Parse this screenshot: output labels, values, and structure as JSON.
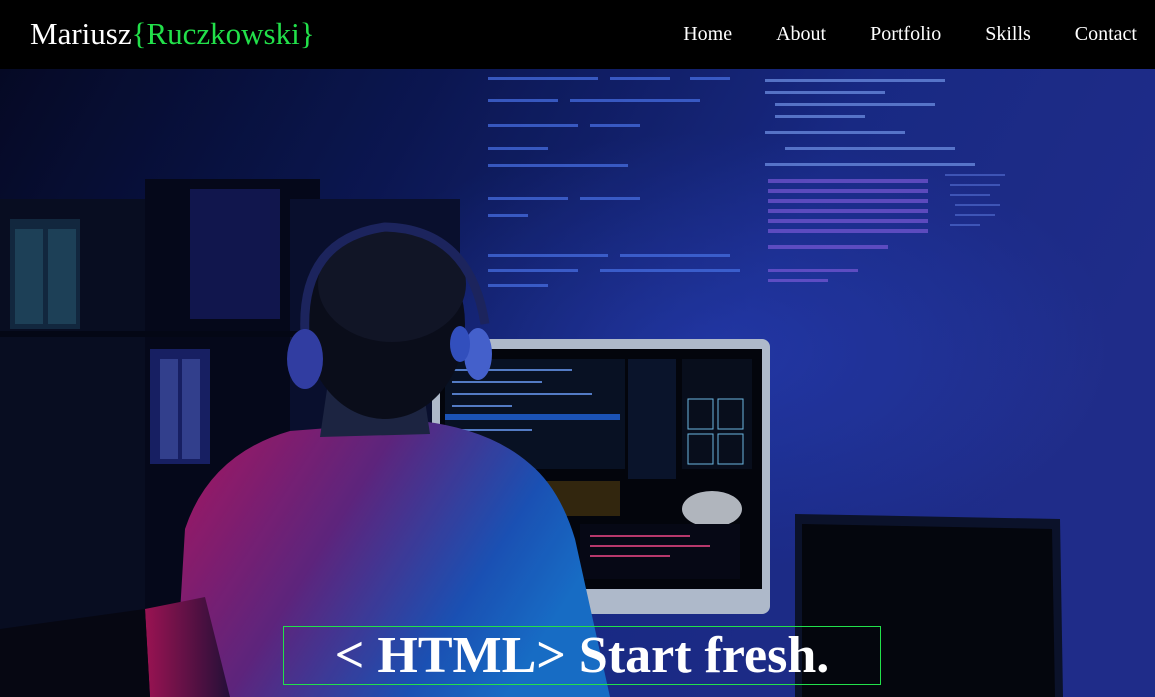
{
  "header": {
    "brand_first": "Mariusz",
    "brand_second": "{Ruczkowski}"
  },
  "nav": {
    "items": [
      "Home",
      "About",
      "Portfolio",
      "Skills",
      "Contact"
    ]
  },
  "hero": {
    "tagline": "< HTML> Start fresh.",
    "image_subject": "developer-at-desk-photo"
  },
  "colors": {
    "background": "#000000",
    "accent": "#22e04a",
    "text": "#ffffff",
    "hero_blue": "#1b2f8f"
  }
}
